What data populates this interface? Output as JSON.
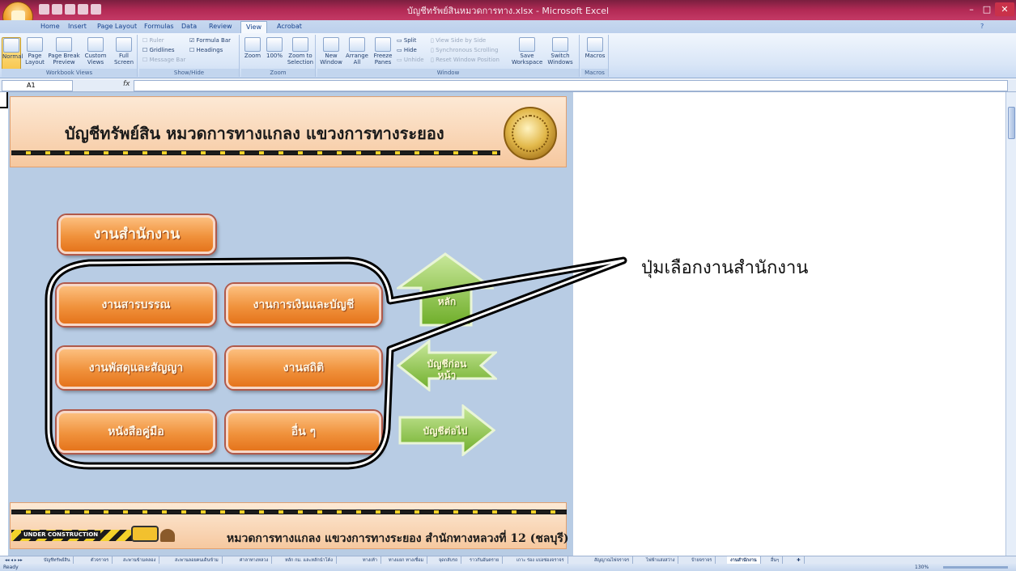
{
  "window": {
    "title": "บัญชีทรัพย์สินหมวดการทาง.xlsx - Microsoft Excel",
    "controls": [
      "–",
      "□",
      "✕"
    ]
  },
  "ribbon": {
    "tabs": [
      "Home",
      "Insert",
      "Page Layout",
      "Formulas",
      "Data",
      "Review",
      "View",
      "Acrobat"
    ],
    "active_tab": "View",
    "groups": {
      "workbook_views": {
        "label": "Workbook Views",
        "buttons": [
          "Normal",
          "Page Layout",
          "Page Break Preview",
          "Custom Views",
          "Full Screen"
        ]
      },
      "show_hide": {
        "label": "Show/Hide",
        "items": [
          "Ruler",
          "Formula Bar",
          "Gridlines",
          "Headings",
          "Message Bar"
        ]
      },
      "zoom": {
        "label": "Zoom",
        "buttons": [
          "Zoom",
          "100%",
          "Zoom to Selection"
        ]
      },
      "window": {
        "label": "Window",
        "buttons": [
          "New Window",
          "Arrange All",
          "Freeze Panes",
          "Split",
          "Hide",
          "Unhide",
          "View Side by Side",
          "Synchronous Scrolling",
          "Reset Window Position",
          "Save Workspace",
          "Switch Windows"
        ]
      },
      "macros": {
        "label": "Macros",
        "buttons": [
          "Macros"
        ]
      }
    }
  },
  "formula_bar": {
    "name_box": "A1",
    "fx": "fx",
    "value": ""
  },
  "sheet": {
    "banner_title": "บัญชีทรัพย์สิน  หมวดการทางแกลง แขวงการทางระยอง",
    "section_button": "งานสำนักงาน",
    "buttons": [
      "งานสารบรรณ",
      "งานการเงินและบัญชี",
      "งานพัสดุและสัญญา",
      "งานสถิติ",
      "หนังสือคู่มือ",
      "อื่น ๆ"
    ],
    "nav": {
      "home": "หลัก",
      "prev": "บัญชีก่อนหน้า",
      "next": "บัญชีต่อไป"
    },
    "footer_text": "หมวดการทางแกลง แขวงการทางระยอง สำนักทางหลวงที่ 12 (ชลบุรี)",
    "under_construction": "UNDER CONSTRUCTION"
  },
  "callout": {
    "text": "ปุ่มเลือกงานสำนักงาน"
  },
  "sheet_tabs": [
    "บัญชีทรัพย์สิน",
    "ตัวจราจร",
    "สะพานข้ามคลอง",
    "สะพานลอยคนเดินข้าม",
    "ศาลาทางหลวง",
    "หลัก กม. และหลักนำโค้ง",
    "ทางเท้า",
    "ทางแยก ทางเชื่อม",
    "จุดกลับรถ",
    "ราวกันอันตราย",
    "เกาะ ร่อง แบ่งช่องจราจร",
    "สัญญาณไฟจราจร",
    "ไฟฟ้าแสงสว่าง",
    "ป้ายจราจร",
    "งานสำนักงาน",
    "อื่นๆ"
  ],
  "active_sheet_tab": "งานสำนักงาน",
  "status": {
    "text": "Ready",
    "zoom": "130%"
  }
}
